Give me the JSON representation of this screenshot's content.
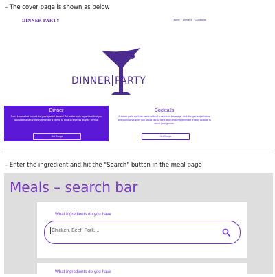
{
  "captions": {
    "cover": "- The cover page is shown as below",
    "meal": "- Enter the ingredient and hit the \"Search\" button in the meal page"
  },
  "site": {
    "brand": "DINNER PARTY",
    "nav": [
      "Home",
      "Dinners",
      "Cocktails"
    ]
  },
  "logo": {
    "left": "DINNER",
    "right": "PARTY"
  },
  "cards": {
    "dinner": {
      "title": "Dinner",
      "description": "Don't know what to cook for your special dinner? Put in the main ingredient that you would like and randomly generate a recipe to cook to impress all your friends.",
      "button": "Get Recipe"
    },
    "cocktails": {
      "title": "Cocktails",
      "description": "A dinner party isn't the same without a delicious beverage, click the get recipe below and put in what spirit you would like to drink and randomly generate a tasty cocktail to serve your guests.",
      "button": "Get Recipe"
    }
  },
  "meals": {
    "title": "Meals – search bar",
    "search_label": "What ingredients do you have",
    "search_placeholder": "Chicken, Beef, Pork....",
    "search_label_2": "What ingredients do you have"
  },
  "colors": {
    "brand_purple": "#5b18d6",
    "accent_purple": "#7a3cc7",
    "panel_gray": "#dedede"
  }
}
